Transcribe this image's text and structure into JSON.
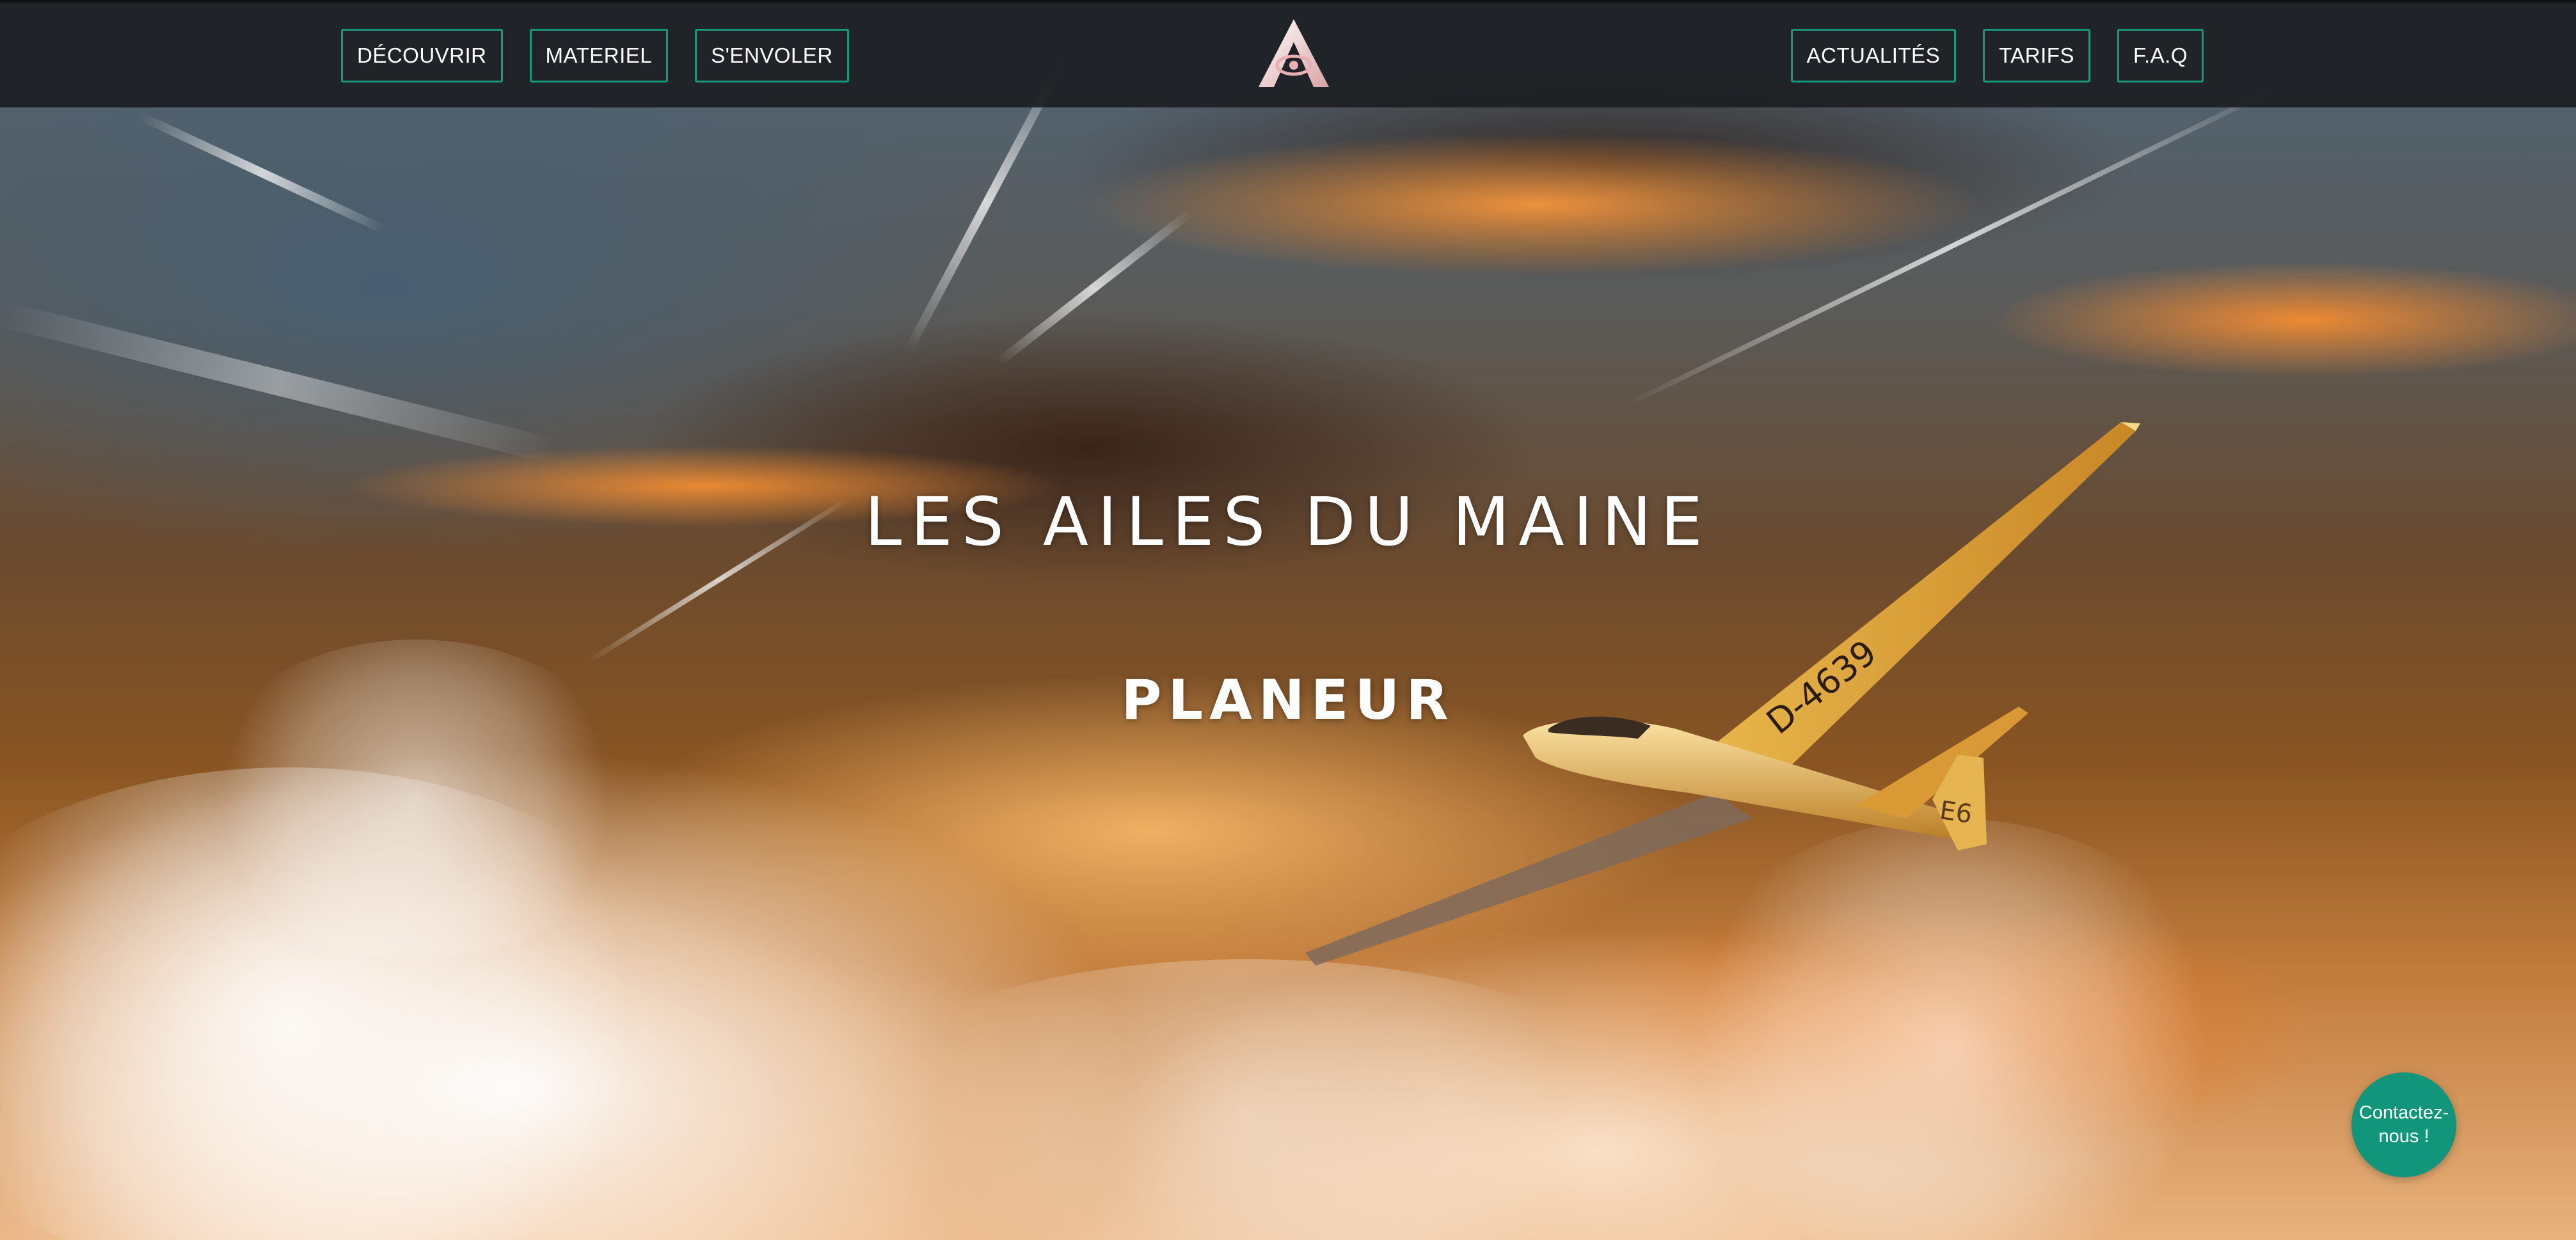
{
  "header": {
    "nav_left": [
      {
        "label": "DÉCOUVRIR"
      },
      {
        "label": "MATERIEL"
      },
      {
        "label": "S'ENVOLER"
      }
    ],
    "nav_right": [
      {
        "label": "ACTUALITÉS"
      },
      {
        "label": "TARIFS"
      },
      {
        "label": "F.A.Q"
      }
    ],
    "logo_icon": "club-logo-icon"
  },
  "hero": {
    "title": "LES AILES DU MAINE",
    "subtitle": "PLANEUR",
    "background": "glider-sunset-sky-photo"
  },
  "contact": {
    "label": "Contactez-nous !"
  },
  "colors": {
    "accent": "#11967b",
    "header_bg": "#1c1e22",
    "text": "#ffffff"
  }
}
